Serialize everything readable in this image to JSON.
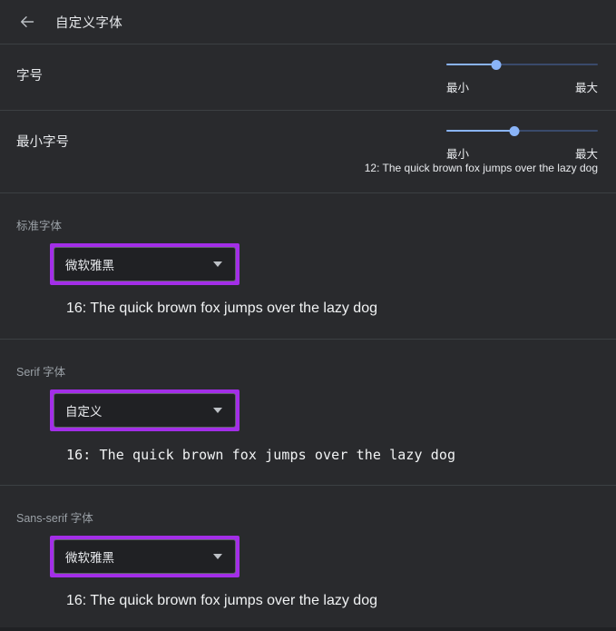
{
  "header": {
    "back_icon": "back-arrow-icon",
    "title": "自定义字体"
  },
  "font_size": {
    "label": "字号",
    "min_label": "最小",
    "max_label": "最大",
    "value_percent": 33
  },
  "minimum_font_size": {
    "label": "最小字号",
    "min_label": "最小",
    "max_label": "最大",
    "value_percent": 45,
    "preview": "12: The quick brown fox jumps over the lazy dog"
  },
  "standard_font": {
    "label": "标准字体",
    "selected": "微软雅黑",
    "caret_icon": "chevron-down-icon",
    "preview": "16: The quick brown fox jumps over the lazy dog"
  },
  "serif_font": {
    "label": "Serif 字体",
    "selected": "自定义",
    "caret_icon": "chevron-down-icon",
    "preview": "16: The quick brown fox jumps over the lazy dog"
  },
  "sans_serif_font": {
    "label": "Sans-serif 字体",
    "selected": "微软雅黑",
    "caret_icon": "chevron-down-icon",
    "preview": "16: The quick brown fox jumps over the lazy dog"
  },
  "colors": {
    "background": "#292a2d",
    "slider_accent": "#8ab4f8",
    "highlight_outline": "#a32ee8",
    "divider": "#3c4043",
    "muted_text": "#9aa0a6"
  }
}
